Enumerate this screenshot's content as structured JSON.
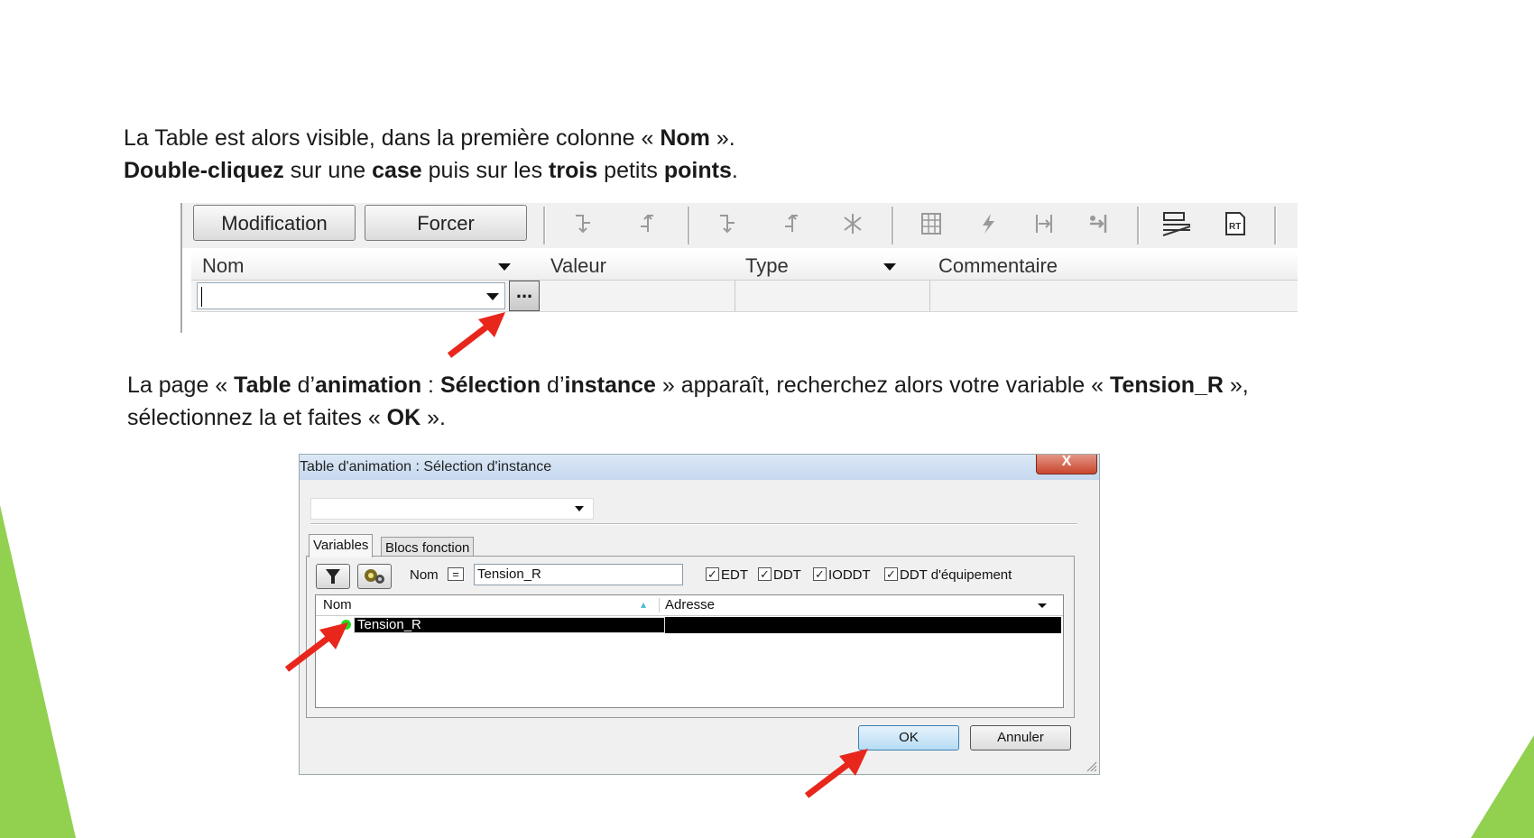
{
  "instructions": {
    "line1": {
      "p1": "La Table est alors visible, dans la première colonne « ",
      "b1": "Nom",
      "p2": " »."
    },
    "line2": {
      "b1": "Double-cliquez",
      "p1": " sur une ",
      "b2": "case",
      "p2": " puis sur les ",
      "b3": "trois",
      "p3": " petits ",
      "b4": "points",
      "p4": "."
    },
    "line3": {
      "p1": "La page « ",
      "b1": "Table",
      "p2": " d’",
      "b2": "animation",
      "p3": " : ",
      "b3": "Sélection",
      "p4": " d’",
      "b4": "instance",
      "p5": " » apparaît, recherchez alors votre variable « ",
      "b5": "Tension_R",
      "p6": " »,"
    },
    "line4": {
      "p1": "sélectionnez la et faites « ",
      "b1": "OK",
      "p2": " »."
    }
  },
  "toolbar": {
    "modification_label": "Modification",
    "forcer_label": "Forcer"
  },
  "grid": {
    "columns": [
      "Nom",
      "Valeur",
      "Type",
      "Commentaire"
    ],
    "dots_label": "..."
  },
  "dialog": {
    "title": "Table d'animation : Sélection d'instance",
    "close_label": "X",
    "tabs": [
      "Variables",
      "Blocs fonction"
    ],
    "name_label": "Nom",
    "equals_label": "=",
    "filter_value": "Tension_R",
    "checkboxes": [
      {
        "label": "EDT",
        "checked": true
      },
      {
        "label": "DDT",
        "checked": true
      },
      {
        "label": "IODDT",
        "checked": true
      },
      {
        "label": "DDT d'équipement",
        "checked": true
      }
    ],
    "list_columns": [
      "Nom",
      "Adresse"
    ],
    "rows": [
      {
        "name": "Tension_R",
        "address": ""
      }
    ],
    "ok_label": "OK",
    "cancel_label": "Annuler"
  },
  "colors": {
    "accent_green": "#92d050",
    "arrow_red": "#e8261c"
  }
}
